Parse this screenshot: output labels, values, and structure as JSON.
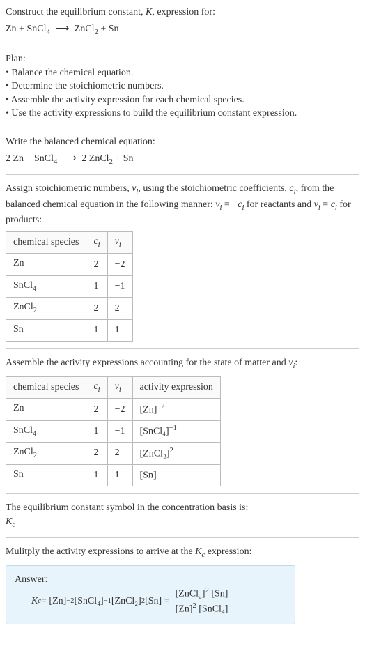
{
  "intro": {
    "line1": "Construct the equilibrium constant, ",
    "k": "K",
    "line1b": ", expression for:",
    "eq_left": "Zn + SnCl",
    "eq_sub1": "4",
    "arrow": "⟶",
    "eq_right1": "ZnCl",
    "eq_sub2": "2",
    "eq_right2": " + Sn"
  },
  "plan": {
    "title": "Plan:",
    "b1": "• Balance the chemical equation.",
    "b2": "• Determine the stoichiometric numbers.",
    "b3": "• Assemble the activity expression for each chemical species.",
    "b4": "• Use the activity expressions to build the equilibrium constant expression."
  },
  "balanced": {
    "title": "Write the balanced chemical equation:",
    "l1": "2 Zn + SnCl",
    "s1": "4",
    "arrow": "⟶",
    "r1": "2 ZnCl",
    "s2": "2",
    "r2": " + Sn"
  },
  "stoich": {
    "l1a": "Assign stoichiometric numbers, ",
    "nu": "ν",
    "i": "i",
    "l1b": ", using the stoichiometric coefficients, ",
    "c": "c",
    "l1c": ", from the balanced chemical equation in the following manner: ",
    "eq1a": " = −",
    "l1d": " for reactants and ",
    "eq2a": " = ",
    "l1e": " for products:",
    "headers": {
      "h1": "chemical species",
      "h2": "cᵢ",
      "h3": "νᵢ"
    },
    "rows": [
      {
        "sp": "Zn",
        "sub": "",
        "c": "2",
        "n": "−2"
      },
      {
        "sp": "SnCl",
        "sub": "4",
        "c": "1",
        "n": "−1"
      },
      {
        "sp": "ZnCl",
        "sub": "2",
        "c": "2",
        "n": "2"
      },
      {
        "sp": "Sn",
        "sub": "",
        "c": "1",
        "n": "1"
      }
    ]
  },
  "activity": {
    "title1": "Assemble the activity expressions accounting for the state of matter and ",
    "title2": ":",
    "headers": {
      "h1": "chemical species",
      "h2": "cᵢ",
      "h3": "νᵢ",
      "h4": "activity expression"
    },
    "rows": [
      {
        "sp": "Zn",
        "sub": "",
        "c": "2",
        "n": "−2",
        "act": "[Zn]",
        "actexp": "−2"
      },
      {
        "sp": "SnCl",
        "sub": "4",
        "c": "1",
        "n": "−1",
        "act": "[SnCl₄]",
        "actexp": "−1"
      },
      {
        "sp": "ZnCl",
        "sub": "2",
        "c": "2",
        "n": "2",
        "act": "[ZnCl₂]",
        "actexp": "2"
      },
      {
        "sp": "Sn",
        "sub": "",
        "c": "1",
        "n": "1",
        "act": "[Sn]",
        "actexp": ""
      }
    ]
  },
  "symbol": {
    "l1": "The equilibrium constant symbol in the concentration basis is:",
    "kc": "K",
    "kcsub": "c"
  },
  "multiply": {
    "l1a": "Mulitply the activity expressions to arrive at the ",
    "l1b": " expression:"
  },
  "answer": {
    "label": "Answer:",
    "kc": "K",
    "kcsub": "c",
    "eq": " = [Zn]",
    "e1": "−2",
    "p2": " [SnCl₄]",
    "e2": "−1",
    "p3": " [ZnCl₂]",
    "e3": "2",
    "p4": " [Sn] = ",
    "num1": "[ZnCl₂]",
    "nume1": "2",
    "num2": " [Sn]",
    "den1": "[Zn]",
    "dene1": "2",
    "den2": " [SnCl₄]"
  }
}
